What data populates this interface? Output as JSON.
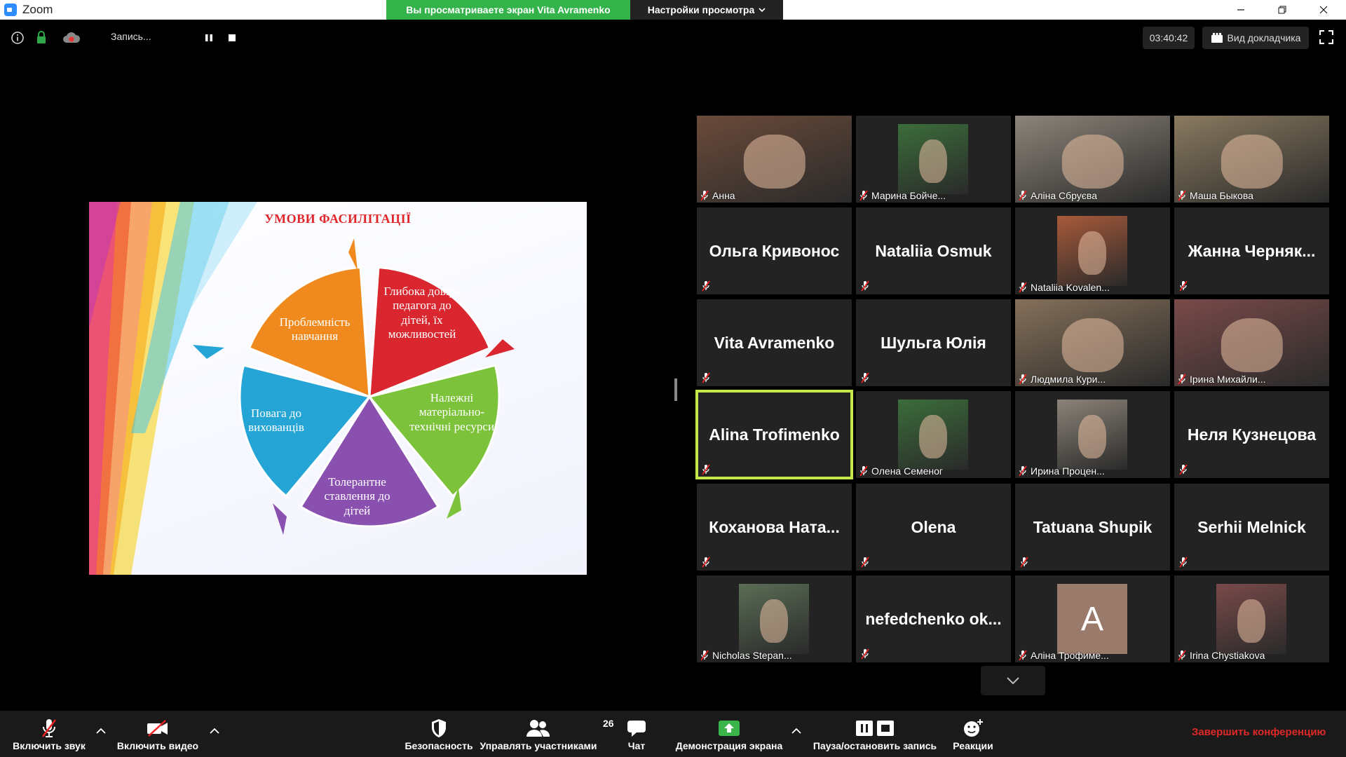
{
  "window": {
    "app_title": "Zoom",
    "viewing_banner": "Вы просматриваете экран Vita Avramenko",
    "view_options": "Настройки просмотра"
  },
  "topbar": {
    "recording_label": "Запись...",
    "timer": "03:40:42",
    "speaker_view": "Вид докладчика"
  },
  "slide": {
    "title": "УМОВИ ФАСИЛІТАЦІЇ",
    "segments": [
      {
        "text": "Проблемність навчання",
        "color": "#f08a1e"
      },
      {
        "text": "Глибока довіра педагога до дітей, їх можливостей",
        "color": "#d9262f"
      },
      {
        "text": "Належні матеріально-технічні ресурси",
        "color": "#7cc23a"
      },
      {
        "text": "Толерантне ставлення до дітей",
        "color": "#8a50b0"
      },
      {
        "text": "Повага до вихованців",
        "color": "#25a5d6"
      }
    ]
  },
  "participants": [
    {
      "name": "Анна",
      "video": true
    },
    {
      "name": "Марина Бойче...",
      "video": true
    },
    {
      "name": "Аліна Сбруєва",
      "video": true
    },
    {
      "name": "Маша Быкова",
      "video": true
    },
    {
      "name": "Ольга Кривонос",
      "video": false
    },
    {
      "name": "Nataliia Osmuk",
      "video": false
    },
    {
      "name": "Nataliia Kovalen...",
      "video": true
    },
    {
      "name": "Жанна Черняк...",
      "video": false
    },
    {
      "name": "Vita Avramenko",
      "video": false
    },
    {
      "name": "Шульга Юлія",
      "video": false
    },
    {
      "name": "Людмила Кури...",
      "video": true
    },
    {
      "name": "Ірина Михайли...",
      "video": true
    },
    {
      "name": "Alina Trofimenko",
      "video": false,
      "active": true
    },
    {
      "name": "Олена Семеног",
      "video": true
    },
    {
      "name": "Ирина Процен...",
      "video": true
    },
    {
      "name": "Неля Кузнецова",
      "video": false
    },
    {
      "name": "Коханова Ната...",
      "video": false
    },
    {
      "name": "Olena",
      "video": false
    },
    {
      "name": "Tatuana Shupik",
      "video": false
    },
    {
      "name": "Serhii Melnick",
      "video": false
    },
    {
      "name": "Nicholas Stepan...",
      "video": true
    },
    {
      "name": "nefedchenko ok...",
      "video": false
    },
    {
      "name": "Аліна Трофиме...",
      "video": true,
      "avatar_letter": "A"
    },
    {
      "name": "Irina Chystiakova",
      "video": true
    }
  ],
  "toolbar": {
    "unmute": "Включить звук",
    "start_video": "Включить видео",
    "security": "Безопасность",
    "participants": "Управлять участниками",
    "participants_count": "26",
    "chat": "Чат",
    "share": "Демонстрация экрана",
    "record": "Пауза/остановить запись",
    "reactions": "Реакции",
    "end": "Завершить конференцию"
  }
}
